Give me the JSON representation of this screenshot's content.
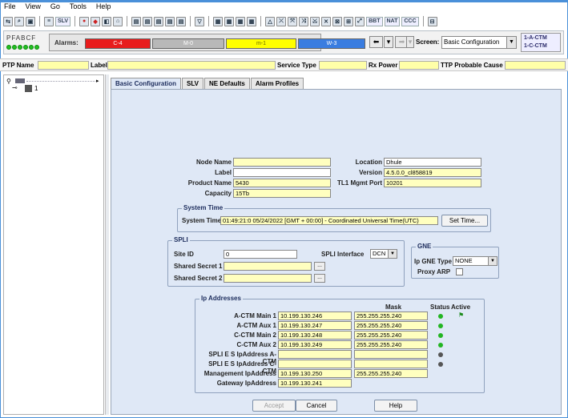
{
  "menu": [
    "File",
    "View",
    "Go",
    "Tools",
    "Help"
  ],
  "toolbar": {
    "slv": "SLV",
    "bbt": "BBT",
    "nat": "NAT",
    "ccc": "CCC"
  },
  "alarm_bar": {
    "pfabcf": "PFABCF",
    "label": "Alarms:",
    "critical": {
      "text": "C-4",
      "color": "#e81c1c"
    },
    "major": {
      "text": "M-0",
      "color": "#b8b8b8"
    },
    "minor": {
      "text": "m-1",
      "color": "#ffff00"
    },
    "warning": {
      "text": "W-3",
      "color": "#3a7de0"
    },
    "screen_label": "Screen:",
    "screen_value": "Basic Configuration",
    "ctm_a": "1-A-CTM",
    "ctm_c": "1-C-CTM"
  },
  "filter_bar": {
    "ptp_name": "PTP Name",
    "label": "Label",
    "service_type": "Service Type",
    "rx_power": "Rx Power",
    "ttp_cause": "TTP Probable Cause"
  },
  "tree": {
    "node_label": "1"
  },
  "tabs": [
    "Basic Configuration",
    "SLV",
    "NE Defaults",
    "Alarm Profiles"
  ],
  "node": {
    "node_name_label": "Node Name",
    "label_label": "Label",
    "product_name_label": "Product Name",
    "product_name": "5430",
    "capacity_label": "Capacity",
    "capacity": "15Tb",
    "location_label": "Location",
    "location": "Dhule",
    "version_label": "Version",
    "version": "4.5.0.0_cl858819",
    "tl1_label": "TL1 Mgmt Port",
    "tl1_port": "10201"
  },
  "system_time": {
    "title": "System Time",
    "label": "System Time",
    "value": "01:49:21:0 05/24/2022   [GMT + 00:00] - Coordinated Universal Time(UTC)",
    "button": "Set Time..."
  },
  "spli": {
    "title": "SPLI",
    "site_id_label": "Site ID",
    "site_id": "0",
    "interface_label": "SPLI Interface",
    "interface": "DCN",
    "secret1_label": "Shared Secret 1",
    "secret2_label": "Shared Secret 2",
    "ellipsis": "..."
  },
  "gne": {
    "title": "GNE",
    "type_label": "Ip GNE Type",
    "type": "NONE",
    "arp_label": "Proxy ARP"
  },
  "ip": {
    "title": "Ip Addresses",
    "mask_head": "Mask",
    "status_head": "Status",
    "active_head": "Active",
    "rows": [
      {
        "label": "A-CTM Main 1",
        "ip": "10.199.130.246",
        "mask": "255.255.255.240",
        "status": "#22b522"
      },
      {
        "label": "A-CTM Aux 1",
        "ip": "10.199.130.247",
        "mask": "255.255.255.240",
        "status": "#22b522"
      },
      {
        "label": "C-CTM Main 2",
        "ip": "10.199.130.248",
        "mask": "255.255.255.240",
        "status": "#22b522"
      },
      {
        "label": "C-CTM Aux 2",
        "ip": "10.199.130.249",
        "mask": "255.255.255.240",
        "status": "#22b522"
      },
      {
        "label": "SPLI E S IpAddress A-CTM",
        "ip": "",
        "mask": "",
        "status": "#555555"
      },
      {
        "label": "SPLI E S IpAddress C-CTM",
        "ip": "",
        "mask": "",
        "status": "#555555"
      },
      {
        "label": "Management IpAddress",
        "ip": "10.199.130.250",
        "mask": "255.255.255.240",
        "status": ""
      },
      {
        "label": "Gateway IpAddress",
        "ip": "10.199.130.241",
        "mask": "",
        "status": ""
      }
    ]
  },
  "buttons": {
    "accept": "Accept",
    "cancel": "Cancel",
    "help": "Help"
  }
}
